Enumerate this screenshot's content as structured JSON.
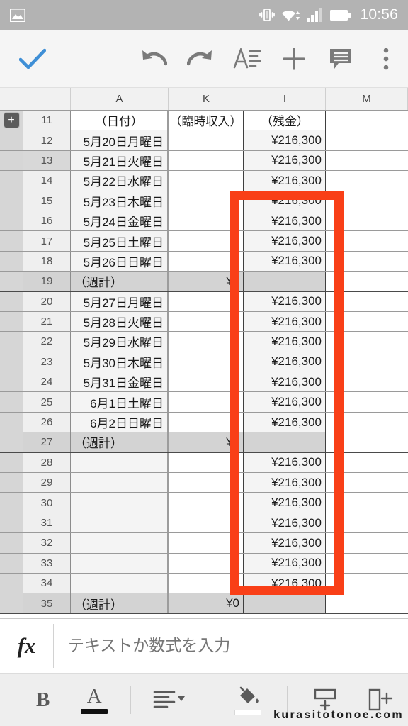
{
  "status_bar": {
    "time": "10:56",
    "icons": [
      "gallery-icon",
      "vibrate-icon",
      "wifi-icon",
      "signal-icon",
      "battery-icon"
    ]
  },
  "toolbar": {
    "accept_label": "✓",
    "items": [
      {
        "name": "accept-icon",
        "label": "✓"
      },
      {
        "name": "undo-icon",
        "label": "↶"
      },
      {
        "name": "redo-icon",
        "label": "↷"
      },
      {
        "name": "text-format-icon",
        "label": "A"
      },
      {
        "name": "add-icon",
        "label": "+"
      },
      {
        "name": "comment-icon",
        "label": "💬"
      },
      {
        "name": "overflow-menu-icon",
        "label": "⋮"
      }
    ]
  },
  "sheet": {
    "expand_button_label": "+",
    "columns": [
      "A",
      "K",
      "I",
      "M"
    ],
    "highlighted_row_header": "13",
    "rows": [
      {
        "num": "11",
        "a": "（日付）",
        "k": "（臨時収入）",
        "i": "（残金）",
        "m": "",
        "type": "header"
      },
      {
        "num": "12",
        "a": "5月20日月曜日",
        "k": "",
        "i": "¥216,300",
        "m": "",
        "type": "data"
      },
      {
        "num": "13",
        "a": "5月21日火曜日",
        "k": "",
        "i": "¥216,300",
        "m": "",
        "type": "data"
      },
      {
        "num": "14",
        "a": "5月22日水曜日",
        "k": "",
        "i": "¥216,300",
        "m": "",
        "type": "data"
      },
      {
        "num": "15",
        "a": "5月23日木曜日",
        "k": "",
        "i": "¥216,300",
        "m": "",
        "type": "data"
      },
      {
        "num": "16",
        "a": "5月24日金曜日",
        "k": "",
        "i": "¥216,300",
        "m": "",
        "type": "data"
      },
      {
        "num": "17",
        "a": "5月25日土曜日",
        "k": "",
        "i": "¥216,300",
        "m": "",
        "type": "data"
      },
      {
        "num": "18",
        "a": "5月26日日曜日",
        "k": "",
        "i": "¥216,300",
        "m": "",
        "type": "data"
      },
      {
        "num": "19",
        "a": "（週計）",
        "k": "¥0",
        "i": "",
        "m": "",
        "type": "total"
      },
      {
        "num": "20",
        "a": "5月27日月曜日",
        "k": "",
        "i": "¥216,300",
        "m": "",
        "type": "data"
      },
      {
        "num": "21",
        "a": "5月28日火曜日",
        "k": "",
        "i": "¥216,300",
        "m": "",
        "type": "data"
      },
      {
        "num": "22",
        "a": "5月29日水曜日",
        "k": "",
        "i": "¥216,300",
        "m": "",
        "type": "data"
      },
      {
        "num": "23",
        "a": "5月30日木曜日",
        "k": "",
        "i": "¥216,300",
        "m": "",
        "type": "data"
      },
      {
        "num": "24",
        "a": "5月31日金曜日",
        "k": "",
        "i": "¥216,300",
        "m": "",
        "type": "data"
      },
      {
        "num": "25",
        "a": "6月1日土曜日",
        "k": "",
        "i": "¥216,300",
        "m": "",
        "type": "data"
      },
      {
        "num": "26",
        "a": "6月2日日曜日",
        "k": "",
        "i": "¥216,300",
        "m": "",
        "type": "data"
      },
      {
        "num": "27",
        "a": "（週計）",
        "k": "¥0",
        "i": "",
        "m": "",
        "type": "total"
      },
      {
        "num": "28",
        "a": "",
        "k": "",
        "i": "¥216,300",
        "m": "",
        "type": "data"
      },
      {
        "num": "29",
        "a": "",
        "k": "",
        "i": "¥216,300",
        "m": "",
        "type": "data"
      },
      {
        "num": "30",
        "a": "",
        "k": "",
        "i": "¥216,300",
        "m": "",
        "type": "data"
      },
      {
        "num": "31",
        "a": "",
        "k": "",
        "i": "¥216,300",
        "m": "",
        "type": "data"
      },
      {
        "num": "32",
        "a": "",
        "k": "",
        "i": "¥216,300",
        "m": "",
        "type": "data"
      },
      {
        "num": "33",
        "a": "",
        "k": "",
        "i": "¥216,300",
        "m": "",
        "type": "data"
      },
      {
        "num": "34",
        "a": "",
        "k": "",
        "i": "¥216,300",
        "m": "",
        "type": "data"
      },
      {
        "num": "35",
        "a": "（週計）",
        "k": "¥0",
        "i": "",
        "m": "",
        "type": "total"
      }
    ]
  },
  "annotation": {
    "shape": "rectangle-outline",
    "color": "#f93f17",
    "covers_column": "I"
  },
  "formula_bar": {
    "fx_label": "fx",
    "placeholder": "テキストか数式を入力",
    "value": ""
  },
  "bottom_toolbar": {
    "bold_label": "B",
    "text_color_label": "A",
    "items": [
      {
        "name": "bold-button",
        "label": "B"
      },
      {
        "name": "text-color-button",
        "label": "A"
      },
      {
        "name": "align-button",
        "label": "≡"
      },
      {
        "name": "fill-color-button",
        "label": "fill"
      },
      {
        "name": "insert-row-button",
        "label": "insert-row"
      },
      {
        "name": "insert-column-button",
        "label": "insert-column"
      }
    ]
  },
  "watermark": {
    "text": "kurasitotonoe.com"
  }
}
